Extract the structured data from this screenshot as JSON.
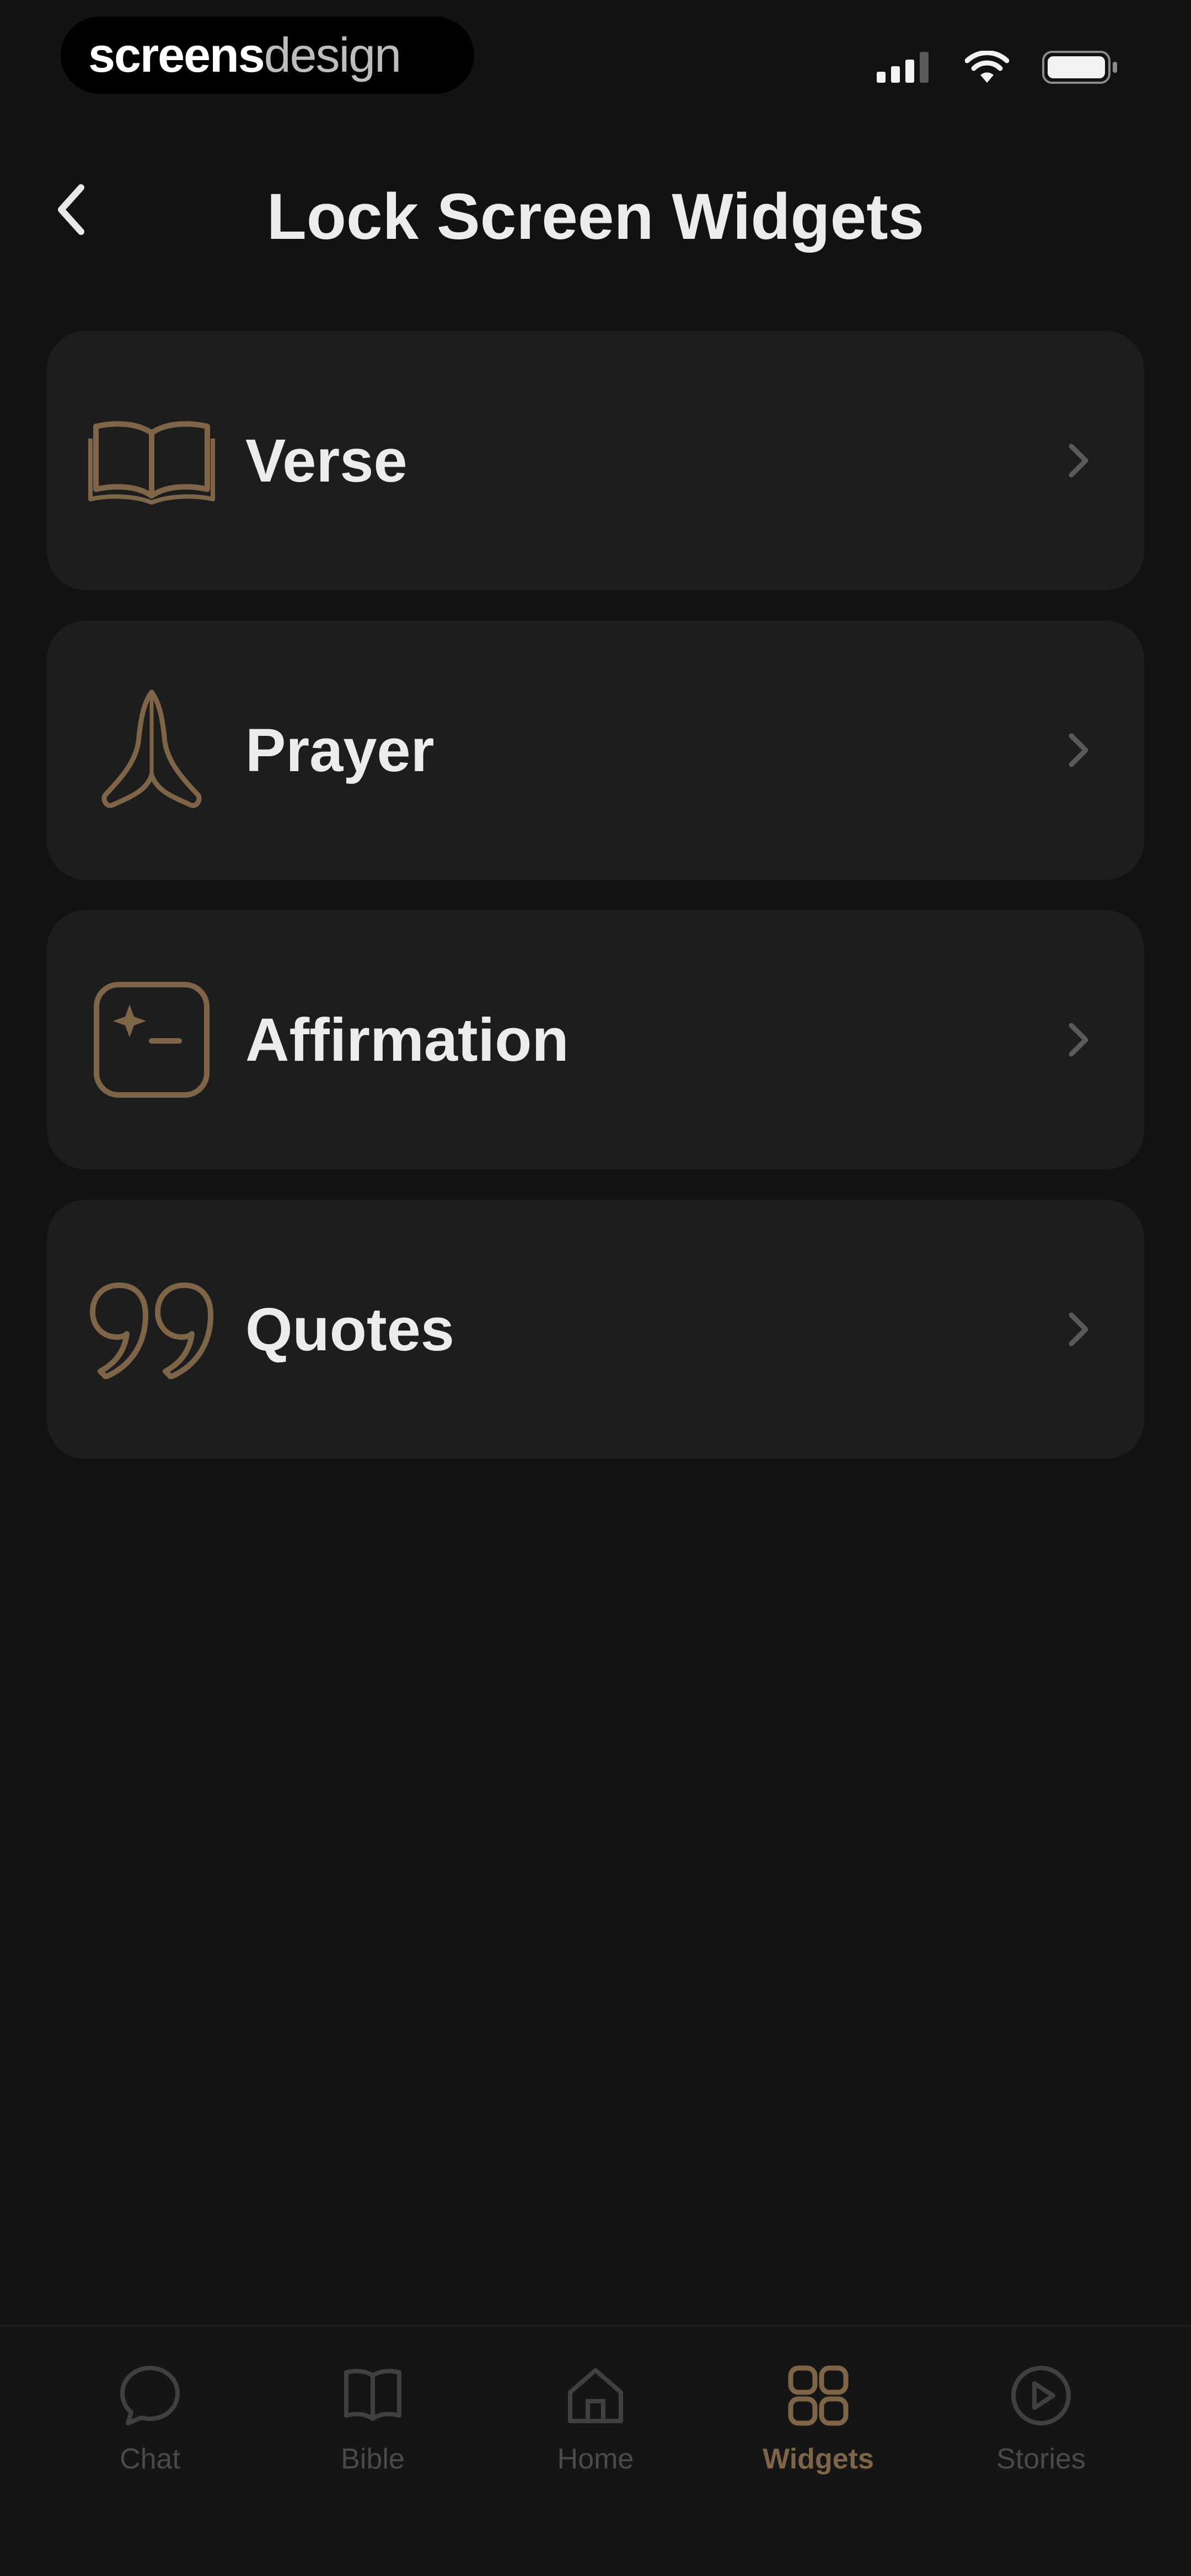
{
  "status_bar": {
    "brand_bold": "screens",
    "brand_light": "design",
    "icons": [
      "signal-icon",
      "wifi-icon",
      "battery-icon"
    ]
  },
  "header": {
    "title": "Lock Screen Widgets",
    "back_icon": "chevron-left-icon"
  },
  "widgets": [
    {
      "label": "Verse",
      "icon": "open-book-icon"
    },
    {
      "label": "Prayer",
      "icon": "praying-hands-icon"
    },
    {
      "label": "Affirmation",
      "icon": "sparkle-square-icon"
    },
    {
      "label": "Quotes",
      "icon": "quote-icon"
    }
  ],
  "tab_bar": {
    "tabs": [
      {
        "label": "Chat",
        "icon": "chat-bubble-icon",
        "active": false
      },
      {
        "label": "Bible",
        "icon": "book-icon",
        "active": false
      },
      {
        "label": "Home",
        "icon": "home-icon",
        "active": false
      },
      {
        "label": "Widgets",
        "icon": "widgets-grid-icon",
        "active": true
      },
      {
        "label": "Stories",
        "icon": "play-circle-icon",
        "active": false
      }
    ]
  },
  "colors": {
    "background": "#121212",
    "card": "#1d1d1d",
    "accent": "#7e6548",
    "text": "#ececec",
    "muted": "#4a4a4a"
  }
}
